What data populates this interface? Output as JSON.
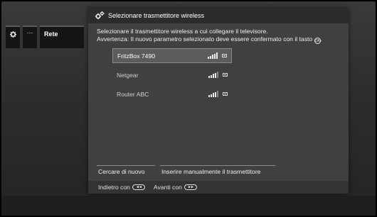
{
  "background_menu": {
    "icons": [
      "gear-icon",
      "more-icon"
    ],
    "more_label": "···",
    "section_label": "Rete"
  },
  "dialog": {
    "title": "Selezionare trasmettitore wireless",
    "title_icon": "gear-icon",
    "message_line1": "Selezionare il trasmettitore wireless a cui collegare il televisore.",
    "message_line2": "Avvertenza: Il nuovo parametro selezionato deve essere confermato con il tasto",
    "ok_key_label": "OK"
  },
  "networks": [
    {
      "name": "FritzBox 7490",
      "selected": true,
      "signal": 5,
      "secured": true
    },
    {
      "name": "Netgear",
      "selected": false,
      "signal": 4,
      "secured": true
    },
    {
      "name": "Router ABC",
      "selected": false,
      "signal": 4,
      "secured": true
    }
  ],
  "actions": {
    "search_again": "Cercare di nuovo",
    "manual_entry": "Inserire manualmente il trasmettitore"
  },
  "footer": {
    "back_label": "Indietro con",
    "back_key": "◄◄",
    "forward_label": "Avanti con",
    "forward_key": "►►"
  },
  "colors": {
    "dialog_bg": "#404040",
    "title_bar": "#2c2c2c",
    "selected_row": "#5c5c5c"
  }
}
